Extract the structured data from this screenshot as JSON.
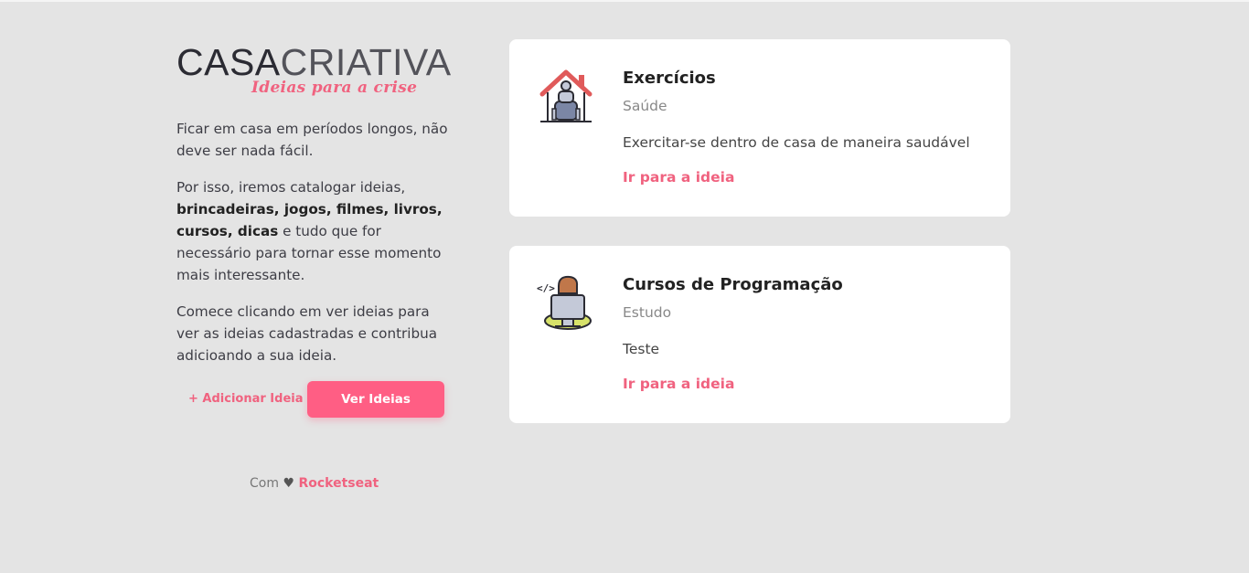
{
  "logo": {
    "bold": "CASA",
    "light": "CRIATIVA",
    "tagline": "Ideias para a crise"
  },
  "intro": {
    "p1": "Ficar em casa em períodos longos, não deve ser nada fácil.",
    "p2_before": "Por isso, iremos catalogar ideias, ",
    "p2_bold": "brincadeiras, jogos, filmes, livros, cursos, dicas",
    "p2_after": " e tudo que for necessário para tornar esse momento mais interessante.",
    "p3": "Comece clicando em ver ideias para ver as ideias cadastradas e contribua adicioando a sua ideia."
  },
  "actions": {
    "add_label": "+ Adicionar Ideia",
    "view_label": "Ver Ideias"
  },
  "footer": {
    "prefix": "Com",
    "heart": "♥",
    "brand": "Rocketseat"
  },
  "ideas": [
    {
      "title": "Exercícios",
      "category": "Saúde",
      "description": "Exercitar-se dentro de casa de maneira saudável",
      "link": "Ir para a ideia",
      "icon": "home-workout-icon"
    },
    {
      "title": "Cursos de Programação",
      "category": "Estudo",
      "description": "Teste",
      "link": "Ir para a ideia",
      "icon": "programmer-icon"
    }
  ],
  "colors": {
    "accent": "#ff5e84",
    "link": "#f0627f",
    "background": "#e4e4e4"
  }
}
